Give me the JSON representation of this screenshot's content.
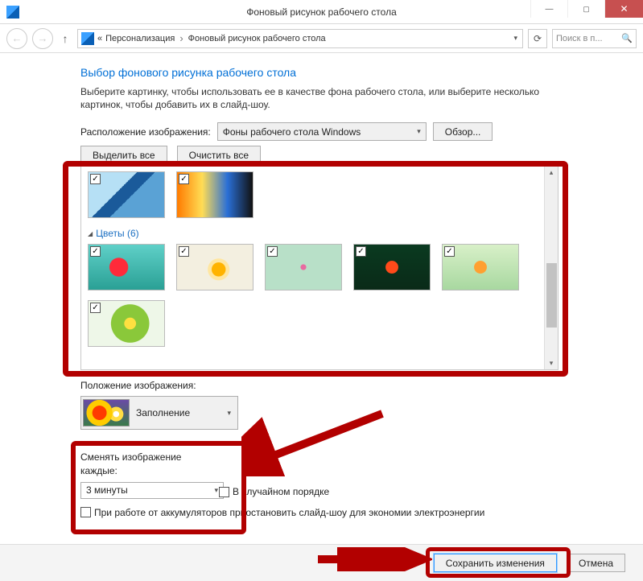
{
  "window": {
    "title": "Фоновый рисунок рабочего стола"
  },
  "nav": {
    "chevrons": "«",
    "crumb1": "Персонализация",
    "crumb2": "Фоновый рисунок рабочего стола",
    "search_placeholder": "Поиск в п..."
  },
  "main": {
    "heading": "Выбор фонового рисунка рабочего стола",
    "description": "Выберите картинку, чтобы использовать ее в качестве фона рабочего стола, или выберите несколько картинок, чтобы добавить их в слайд-шоу.",
    "location_label": "Расположение изображения:",
    "location_combo": "Фоны рабочего стола Windows",
    "browse_btn": "Обзор...",
    "select_all_btn": "Выделить все",
    "clear_all_btn": "Очистить все",
    "group_flowers": "Цветы (6)",
    "position_label": "Положение изображения:",
    "position_combo": "Заполнение",
    "change_label": "Сменять изображение каждые:",
    "change_combo": "3 минуты",
    "random_cb": "В случайном порядке",
    "battery_cb": "При работе от аккумуляторов приостановить слайд-шоу для экономии электроэнергии",
    "save_btn": "Сохранить изменения",
    "cancel_btn": "Отмена"
  }
}
